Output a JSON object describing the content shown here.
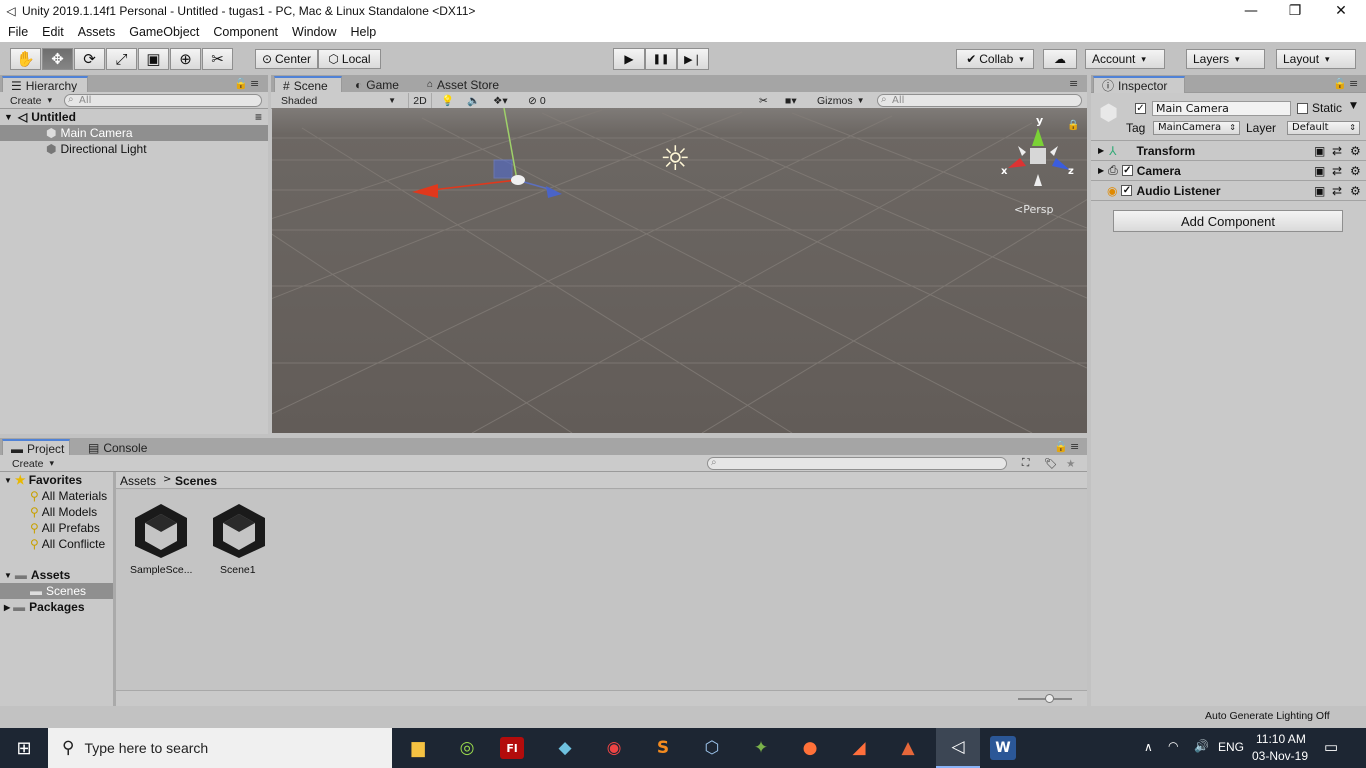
{
  "window": {
    "title": "Unity 2019.1.14f1 Personal - Untitled - tugas1 - PC, Mac & Linux Standalone <DX11>",
    "minimize": "—",
    "maximize": "❐",
    "close": "✕"
  },
  "menu": [
    "File",
    "Edit",
    "Assets",
    "GameObject",
    "Component",
    "Window",
    "Help"
  ],
  "toolbar": {
    "tools": [
      {
        "name": "hand-tool",
        "glyph": "✋"
      },
      {
        "name": "move-tool",
        "glyph": "✥"
      },
      {
        "name": "rotate-tool",
        "glyph": "⟳"
      },
      {
        "name": "scale-tool",
        "glyph": "⤢"
      },
      {
        "name": "rect-tool",
        "glyph": "▣"
      },
      {
        "name": "transform-tool",
        "glyph": "⊕"
      },
      {
        "name": "custom-tool",
        "glyph": "✂"
      }
    ],
    "pivot_label": "Center",
    "space_label": "Local",
    "play": "▶",
    "pause": "❚❚",
    "step": "▶❘",
    "collab_label": "Collab",
    "cloud": "☁",
    "account_label": "Account",
    "layers_label": "Layers",
    "layout_label": "Layout"
  },
  "hierarchy": {
    "tab_label": "Hierarchy",
    "create_label": "Create",
    "search_placeholder": "All",
    "scene_name": "Untitled",
    "items": [
      "Main Camera",
      "Directional Light"
    ]
  },
  "scene_tabs": [
    {
      "label": "Scene",
      "icon": "#"
    },
    {
      "label": "Game",
      "icon": "◐"
    },
    {
      "label": "Asset Store",
      "icon": "🛍"
    }
  ],
  "scene_toolbar": {
    "shading": "Shaded",
    "mode_2d": "2D",
    "hidden_count": "0",
    "gizmos_label": "Gizmos",
    "search_placeholder": "All"
  },
  "scene_gizmo": {
    "y": "y",
    "x": "x",
    "z": "z",
    "projection": "Persp"
  },
  "inspector": {
    "tab_label": "Inspector",
    "object_name": "Main Camera",
    "static_label": "Static",
    "tag_label": "Tag",
    "tag_value": "MainCamera",
    "layer_label": "Layer",
    "layer_value": "Default",
    "components": [
      "Transform",
      "Camera",
      "Audio Listener"
    ],
    "add_component_label": "Add Component"
  },
  "project": {
    "tab_label": "Project",
    "console_tab_label": "Console",
    "create_label": "Create",
    "favorites_label": "Favorites",
    "favorites": [
      "All Materials",
      "All Models",
      "All Prefabs",
      "All Conflicte"
    ],
    "assets_label": "Assets",
    "scenes_folder": "Scenes",
    "packages_label": "Packages",
    "breadcrumb": [
      "Assets",
      "Scenes"
    ],
    "files": [
      "SampleSce...",
      "Scene1"
    ]
  },
  "status": {
    "message": "Auto Generate Lighting Off"
  },
  "taskbar": {
    "search_placeholder": "Type here to search",
    "language": "ENG",
    "time": "11:10 AM",
    "date": "03-Nov-19"
  }
}
